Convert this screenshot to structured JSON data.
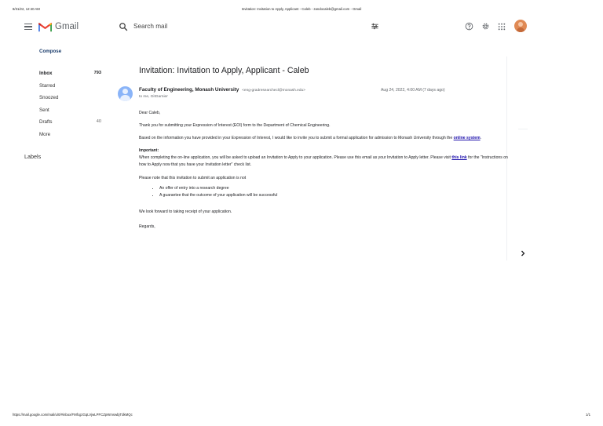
{
  "print_header": {
    "datetime": "8/31/22, 12:40 AM",
    "title": "Invitation: Invitation to Apply, Applicant - Caleb - zandocaleb@gmail.com - Gmail"
  },
  "print_footer": {
    "url": "https://mail.google.com/mail/u/0/#inbox/FMfcgzGqLVjwLPFCZpWmswbjTdkMQc",
    "page": "1/1"
  },
  "app": {
    "name": "Gmail"
  },
  "search": {
    "placeholder": "Search mail"
  },
  "sidebar": {
    "compose_label": "Compose",
    "items": [
      {
        "label": "Inbox",
        "count": "793"
      },
      {
        "label": "Starred",
        "count": ""
      },
      {
        "label": "Snoozed",
        "count": ""
      },
      {
        "label": "Sent",
        "count": ""
      },
      {
        "label": "Drafts",
        "count": "40"
      },
      {
        "label": "More",
        "count": ""
      }
    ],
    "labels_heading": "Labels"
  },
  "message": {
    "subject": "Invitation: Invitation to Apply, Applicant - Caleb",
    "sender_name": "Faculty of Engineering, Monash University",
    "sender_email": "<eng-gradresearchecl@monash.edu>",
    "to_line": "to me, GitGarnier",
    "date": "Aug 24, 2022, 4:00 AM (7 days ago)",
    "greeting": "Dear Caleb,",
    "para1": "Thank you for submitting your Expression of Interest (EOI) form to the Department of Chemical Engineering.",
    "para2_text": "Based on the information you have provided in your Expression of Interest, I would like to invite you to submit a formal application for admission to Monash University through the ",
    "para2_link": "online system",
    "para2_end": ".",
    "important_heading": "Important:",
    "important_text": "When completing the on-line application, you will be asked to upload an Invitation to Apply to your application. Please use this email as your Invitation to Apply letter. Please visit ",
    "important_link": "this link",
    "important_end": " for the \"Instructions on how to Apply now that you have your Invitation letter\" check list.",
    "note": "Please note that this invitation to submit an application is not",
    "bullets": [
      "An offer of entry into a research degree",
      "A guarantee that the outcome of your application will be successful"
    ],
    "closing": "We look forward to taking receipt of your application.",
    "signoff": "Regards,"
  },
  "colors": {
    "accent_red": "#ea4335",
    "link": "#1a0dab",
    "avatar": "#e08a55",
    "sender_avatar": "#8ab4f8"
  },
  "icons": [
    "menu-icon",
    "gmail-logo",
    "search-icon",
    "filter-icon",
    "help-icon",
    "gear-icon",
    "apps-icon",
    "avatar",
    "chevron-right-icon"
  ]
}
